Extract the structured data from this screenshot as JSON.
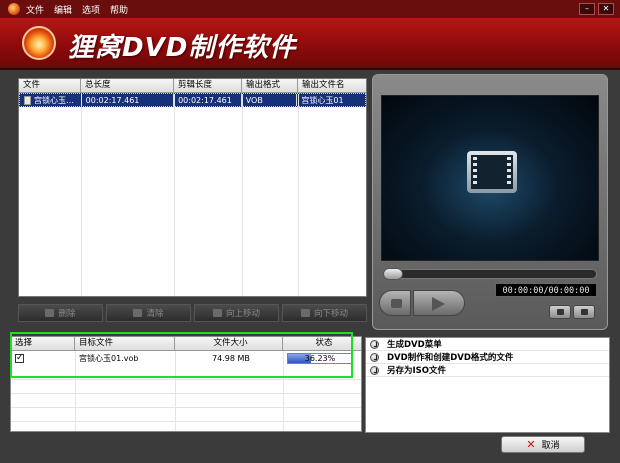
{
  "menu": {
    "items": [
      "文件",
      "编辑",
      "选项",
      "帮助"
    ]
  },
  "window": {
    "minimize": "–",
    "close": "✕"
  },
  "banner": {
    "title": "狸窝DVD制作软件"
  },
  "file_table": {
    "columns": [
      "文件",
      "总长度",
      "剪辑长度",
      "输出格式",
      "输出文件名"
    ],
    "rows": [
      {
        "file": "宫锁心玉…",
        "total_length": "00:02:17.461",
        "clip_length": "00:02:17.461",
        "format": "VOB",
        "output_name": "宫锁心玉01"
      }
    ]
  },
  "buttons": {
    "delete": "删除",
    "clear": "清除",
    "move_up": "向上移动",
    "move_down": "向下移动",
    "cancel": "取消"
  },
  "player": {
    "timecode": "00:00:00/00:00:00",
    "seek_position": 0
  },
  "task_table": {
    "columns": [
      "选择",
      "目标文件",
      "文件大小",
      "状态"
    ],
    "rows": [
      {
        "selected": true,
        "target": "宫锁心玉01.vob",
        "size": "74.98 MB",
        "status": "36.23%",
        "progress": 0.3623
      }
    ]
  },
  "options": [
    "生成DVD菜单",
    "DVD制作和创建DVD格式的文件",
    "另存为ISO文件"
  ],
  "colors": {
    "banner": "#b81616",
    "highlight": "#18e022",
    "selection": "#17307a"
  }
}
